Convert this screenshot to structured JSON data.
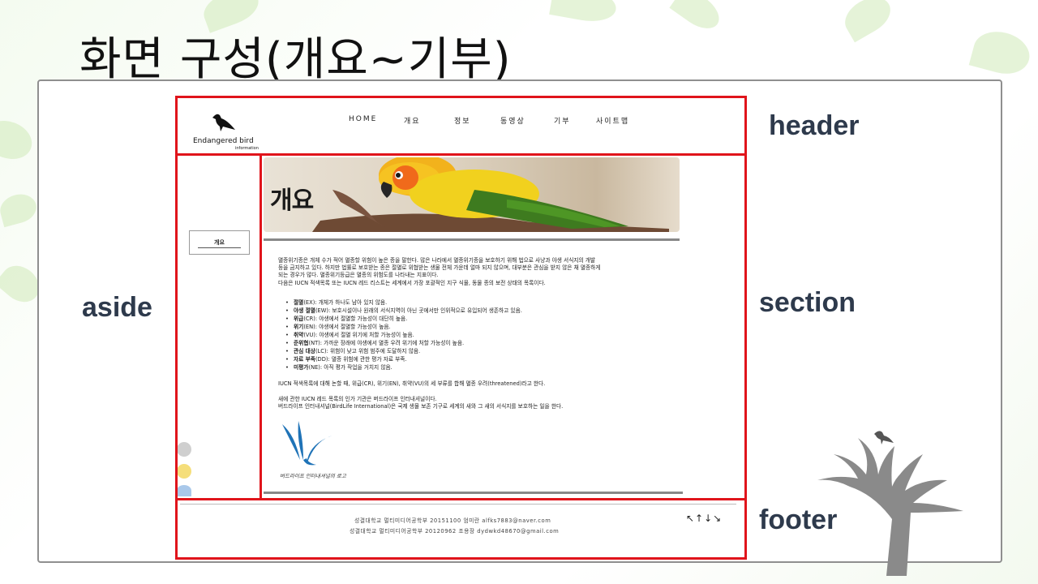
{
  "slide": {
    "title": "화면 구성(개요~기부)"
  },
  "labels": {
    "header": "header",
    "aside": "aside",
    "section": "section",
    "footer": "footer"
  },
  "site": {
    "logo_text": "Endangered bird",
    "logo_sub": "information",
    "nav": [
      "HOME",
      "개요",
      "정보",
      "동영상",
      "기부",
      "사이트맵"
    ],
    "banner_title": "개요",
    "aside_button": "개요",
    "intro": [
      "멸종위기종은 개체 수가 적어 멸종할 위험이 높은 종을 말한다. 많은 나라에서 멸종위기종을 보호하기 위해 법으로 사냥과 야생 서식지의 개발",
      "등을 금지하고 있다. 하지만 법률로 보호받는 종은 절멸로 위협받는 생물 전체 가운데 얼마 되지 않으며, 대부분은 관심을 받지 않은 채 멸종하게",
      "되는 경우가 많다. 멸종위기등급은 멸종의 위험도를 나타내는 지표이다.",
      "다음은 IUCN 적색목록 또는 IUCN 레드 리스트는 세계에서 가장 포괄적인 지구 식물, 동물 종의 보전 상태의 목록이다."
    ],
    "categories": [
      {
        "term": "절멸",
        "rest": "(EX): 개체가 하나도 남아 있지 않음."
      },
      {
        "term": "야생 절멸",
        "rest": "(EW): 보호시설이나 원래의 서식지역이 아닌 곳에서만 인위적으로 유입되어 생존하고 있음."
      },
      {
        "term": "위급",
        "rest": "(CR): 야생에서 절멸할 가능성이 대단히 높음."
      },
      {
        "term": "위기",
        "rest": "(EN): 야생에서 절멸할 가능성이 높음."
      },
      {
        "term": "취약",
        "rest": "(VU): 야생에서 절멸 위기에 처할 가능성이 높음."
      },
      {
        "term": "준위협",
        "rest": "(NT): 가까운 장래에 야생에서 멸종 우려 위기에 처할 가능성이 높음."
      },
      {
        "term": "관심 대상",
        "rest": "(LC): 위험이 낮고 위험 범주에 도달하지 않음."
      },
      {
        "term": "자료 부족",
        "rest": "(DD): 멸종 위험에 관한 평가 자료 부족."
      },
      {
        "term": "미평가",
        "rest": "(NE): 아직 평가 작업을 거치지 않음."
      }
    ],
    "para2": "IUCN 적색목록에 대해 논할 때, 위급(CR), 위기(EN), 취약(VU)의 세 부류를 합해 멸종 우려(threatened)라고 한다.",
    "para3": [
      "새에 관한 IUCN 레드 목록의 인가 기관은 버드라이프 인터내셔널이다.",
      "버드라이프 인터내셔널(BirdLife International)은 국제 생물 보존 기구로 세계의 새와 그 새의 서식지를 보호하는 일을 한다."
    ],
    "logo_caption": "버드라이프 인터내셔널의 로고",
    "footer_lines": [
      "성결대학교 멀티미디어공학부 20151100 엄미란 alfks7883@naver.com",
      "성결대학교 멀티미디어공학부 20120962 조용장 dydwkd48670@gmail.com"
    ],
    "footer_arrows": "↖↑↓↘"
  },
  "colors": {
    "red_box": "#e0141b",
    "label_text": "#2e3a4c",
    "birdlife_blue": "#1f73b7"
  }
}
